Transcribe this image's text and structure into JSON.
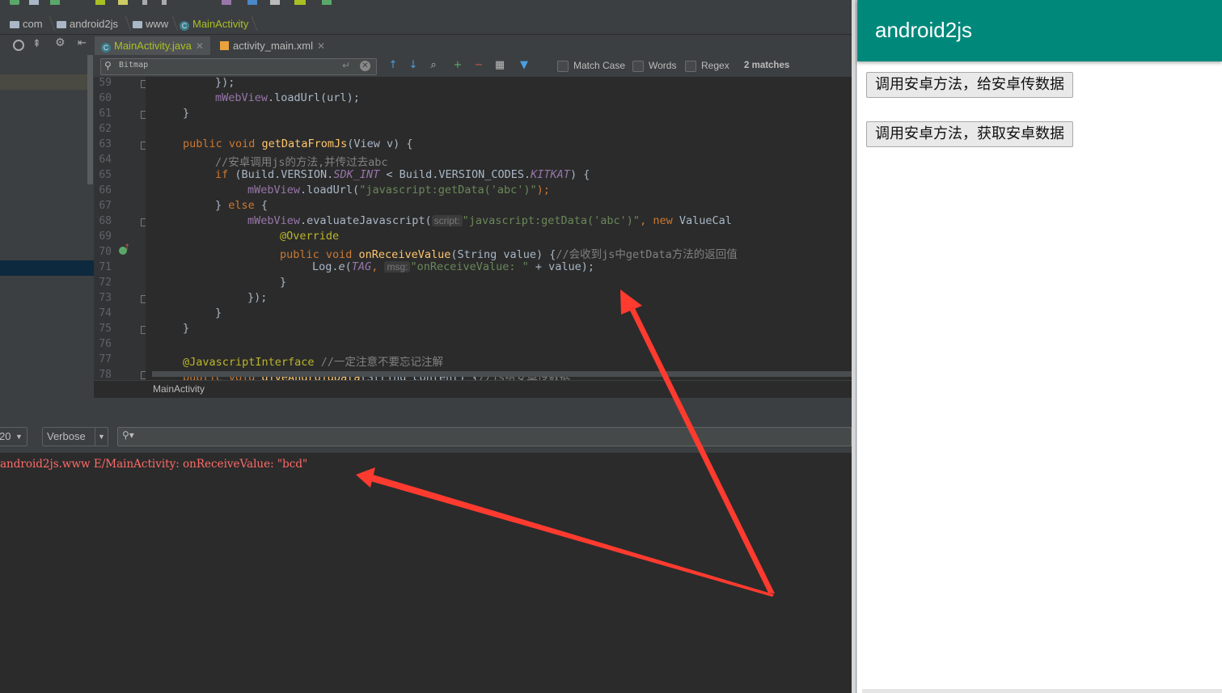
{
  "ide": {
    "breadcrumb": [
      {
        "label": "com",
        "kind": "folder"
      },
      {
        "label": "android2js",
        "kind": "folder"
      },
      {
        "label": "www",
        "kind": "folder"
      },
      {
        "label": "MainActivity",
        "kind": "class"
      }
    ],
    "tabs": [
      {
        "label": "MainActivity.java",
        "active": true
      },
      {
        "label": "activity_main.xml",
        "active": false
      }
    ],
    "find": {
      "query": "Bitmap",
      "match_case_label": "Match Case",
      "words_label": "Words",
      "regex_label": "Regex",
      "matches": "2 matches",
      "match_case": false,
      "words": false,
      "regex": false
    },
    "gutter_numbers": [
      "59",
      "60",
      "61",
      "62",
      "63",
      "64",
      "65",
      "66",
      "67",
      "68",
      "69",
      "70",
      "71",
      "72",
      "73",
      "74",
      "75",
      "76",
      "77",
      "78"
    ],
    "code": {
      "l59": "});",
      "l60a": "mWebView",
      "l60b": ".loadUrl(url);",
      "l61": "}",
      "l63_kw": "public void ",
      "l63_fn": "getDataFromJs",
      "l63_rest": "(View v) {",
      "l64": "//安卓调用js的方法,并传过去abc",
      "l65_kw": "if ",
      "l65_a": "(Build.VERSION.",
      "l65_f1": "SDK_INT",
      "l65_b": " < Build.VERSION_CODES.",
      "l65_f2": "KITKAT",
      "l65_c": ") {",
      "l66a": "mWebView",
      "l66b": ".loadUrl(",
      "l66s": "\"javascript:getData('abc')\"",
      "l66c": ");",
      "l67a": "} ",
      "l67kw": "else",
      "l67b": " {",
      "l68a": "mWebView",
      "l68b": ".evaluateJavascript(",
      "l68hint": "script:",
      "l68s": "\"javascript:getData('abc')\"",
      "l68c": ", ",
      "l68kw": "new",
      "l68d": " ValueCal",
      "l69": "@Override",
      "l70kw": "public void ",
      "l70fn": "onReceiveValue",
      "l70a": "(String value) {",
      "l70cmt": "//会收到js中getData方法的返回值",
      "l71a": "Log.",
      "l71e": "e",
      "l71b": "(",
      "l71tag": "TAG",
      "l71c": ", ",
      "l71hint": "msg:",
      "l71s": "\"onReceiveValue: \"",
      "l71d": " + value);",
      "l72": "}",
      "l73": "});",
      "l74": "}",
      "l75": "}",
      "l77ann": "@JavascriptInterface",
      "l77cmt": " //一定注意不要忘记注解",
      "l78kw": "public void ",
      "l78fn": "giveAndroidData",
      "l78a": "(String content) {",
      "l78cmt": "//js给安卓传数据"
    },
    "code_crumb": "MainActivity",
    "logcat": {
      "device_combo": "20",
      "level": "Verbose",
      "line": "android2js.www E/MainActivity: onReceiveValue: \"bcd\""
    }
  },
  "device": {
    "app_title": "android2js",
    "app_bar_color": "#00897b",
    "buttons": [
      {
        "label": "调用安卓方法，给安卓传数据"
      },
      {
        "label": "调用安卓方法，获取安卓数据"
      }
    ]
  },
  "colors": {
    "arrow": "#ff3b30",
    "log_error": "#ff6b68"
  }
}
